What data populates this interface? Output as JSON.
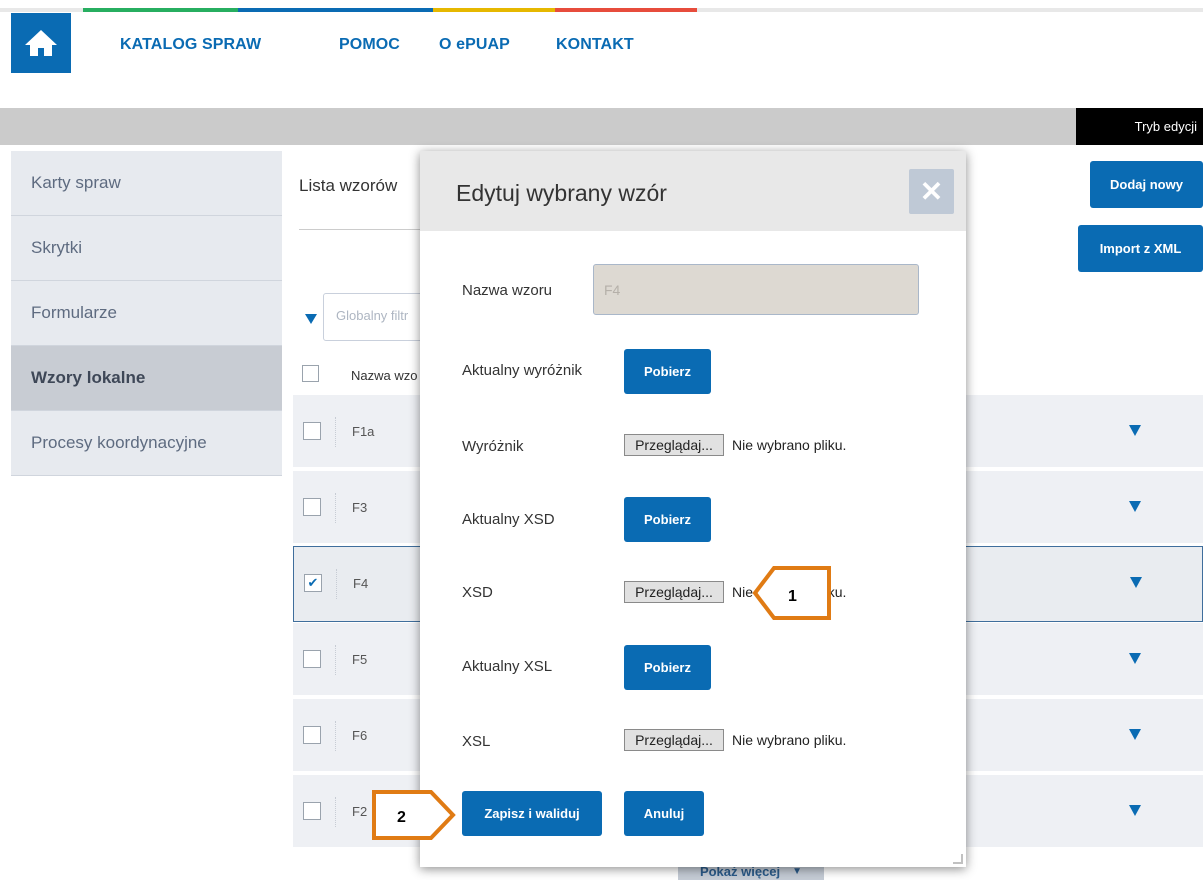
{
  "topnav": {
    "items": [
      "KATALOG SPRAW",
      "POMOC",
      "O ePUAP",
      "KONTAKT"
    ],
    "stripe_colors": [
      "#27ae60",
      "#0a6bb3",
      "#e6b800",
      "#e74c3c"
    ]
  },
  "mode_label": "Tryb edycji",
  "sidebar": {
    "items": [
      {
        "label": "Karty spraw"
      },
      {
        "label": "Skrytki"
      },
      {
        "label": "Formularze"
      },
      {
        "label": "Wzory lokalne"
      },
      {
        "label": "Procesy koordynacyjne"
      }
    ],
    "active_index": 3
  },
  "content": {
    "title": "Lista wzorów",
    "add_button": "Dodaj nowy",
    "import_button": "Import z XML",
    "filter_placeholder": "Globalny filtr",
    "column_header": "Nazwa wzo",
    "rows": [
      {
        "name": "F1a",
        "checked": false
      },
      {
        "name": "F3",
        "checked": false
      },
      {
        "name": "F4",
        "checked": true
      },
      {
        "name": "F5",
        "checked": false
      },
      {
        "name": "F6",
        "checked": false
      },
      {
        "name": "F2",
        "checked": false
      }
    ],
    "more_button": "Pokaż więcej"
  },
  "modal": {
    "title": "Edytuj wybrany wzór",
    "close_symbol": "✕",
    "fields": {
      "nazwa_label": "Nazwa wzoru",
      "nazwa_value": "F4",
      "akt_wyroznik_label": "Aktualny wyróżnik",
      "wyroznik_label": "Wyróżnik",
      "akt_xsd_label": "Aktualny XSD",
      "xsd_label": "XSD",
      "akt_xsl_label": "Aktualny XSL",
      "xsl_label": "XSL"
    },
    "download_label": "Pobierz",
    "browse_label": "Przeglądaj...",
    "no_file_text": "Nie wybrano pliku.",
    "save_button": "Zapisz i waliduj",
    "cancel_button": "Anuluj"
  },
  "callouts": [
    "1",
    "2"
  ],
  "colors": {
    "primary": "#0a6bb3",
    "callout": "#e07b14"
  }
}
